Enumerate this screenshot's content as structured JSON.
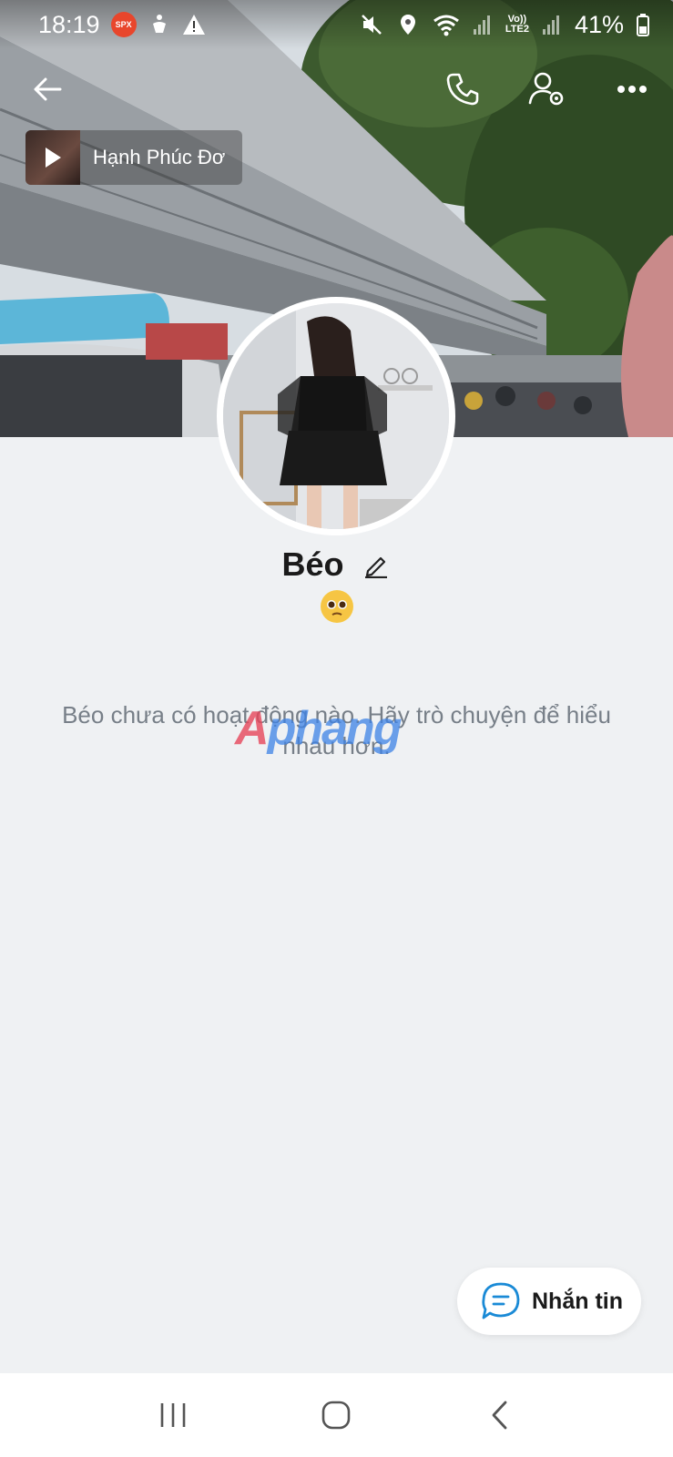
{
  "status_bar": {
    "time": "18:19",
    "spx_label": "SPX",
    "lte_top": "Vo))",
    "lte_bottom": "LTE2",
    "battery": "41%"
  },
  "music": {
    "title": "Hạnh Phúc Đơ"
  },
  "profile": {
    "name": "Béo",
    "status_emoji": "pleading-face"
  },
  "feed": {
    "empty_message": "Béo chưa có hoạt động nào. Hãy trò chuyện để hiểu nhau hơn."
  },
  "watermark": {
    "first": "A",
    "rest": "phang"
  },
  "actions": {
    "message_label": "Nhắn tin"
  },
  "colors": {
    "background": "#eff1f3",
    "accent": "#1a8ad6"
  }
}
